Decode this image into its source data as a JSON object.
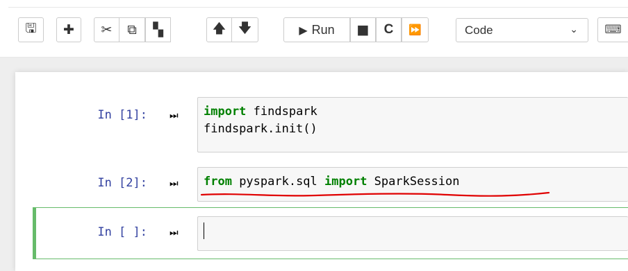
{
  "toolbar": {
    "buttons": [
      {
        "name": "save-button",
        "icon": "save-icon",
        "glyph": "🖫"
      },
      {
        "name": "insert-cell-button",
        "icon": "plus-icon",
        "glyph": "✚"
      },
      {
        "name": "cut-button",
        "icon": "scissors-icon",
        "glyph": "✂"
      },
      {
        "name": "copy-button",
        "icon": "copy-icon",
        "glyph": "⧉"
      },
      {
        "name": "paste-button",
        "icon": "paste-icon",
        "glyph": "▚"
      },
      {
        "name": "move-up-button",
        "icon": "arrow-up-icon",
        "glyph": "🡅"
      },
      {
        "name": "move-down-button",
        "icon": "arrow-down-icon",
        "glyph": "🡇"
      },
      {
        "name": "interrupt-button",
        "icon": "stop-icon",
        "glyph": "■"
      },
      {
        "name": "restart-button",
        "icon": "restart-icon",
        "glyph": "C"
      },
      {
        "name": "restart-run-all-button",
        "icon": "fast-forward-icon",
        "glyph": "⏩"
      }
    ],
    "run_label": "Run",
    "run_glyph": "▶",
    "cell_type_value": "Code",
    "chevron_glyph": "⌄",
    "keyboard_glyph": "⌨"
  },
  "cells": [
    {
      "prompt": "In [1]:",
      "run_glyph": "⏭",
      "lines": [
        [
          {
            "t": "import",
            "kw": true
          },
          {
            "t": " findspark",
            "kw": false
          }
        ],
        [
          {
            "t": "findspark.init()",
            "kw": false
          }
        ]
      ]
    },
    {
      "prompt": "In [2]:",
      "run_glyph": "⏭",
      "lines": [
        [
          {
            "t": "from",
            "kw": true
          },
          {
            "t": " pyspark.sql ",
            "kw": false
          },
          {
            "t": "import",
            "kw": true
          },
          {
            "t": " SparkSession",
            "kw": false
          }
        ]
      ]
    },
    {
      "prompt": "In [ ]:",
      "run_glyph": "⏭",
      "lines": []
    }
  ],
  "colors": {
    "keyword": "#008000",
    "prompt": "#303f9f",
    "selected_border": "#66bb6a",
    "annotation": "#e00000"
  }
}
